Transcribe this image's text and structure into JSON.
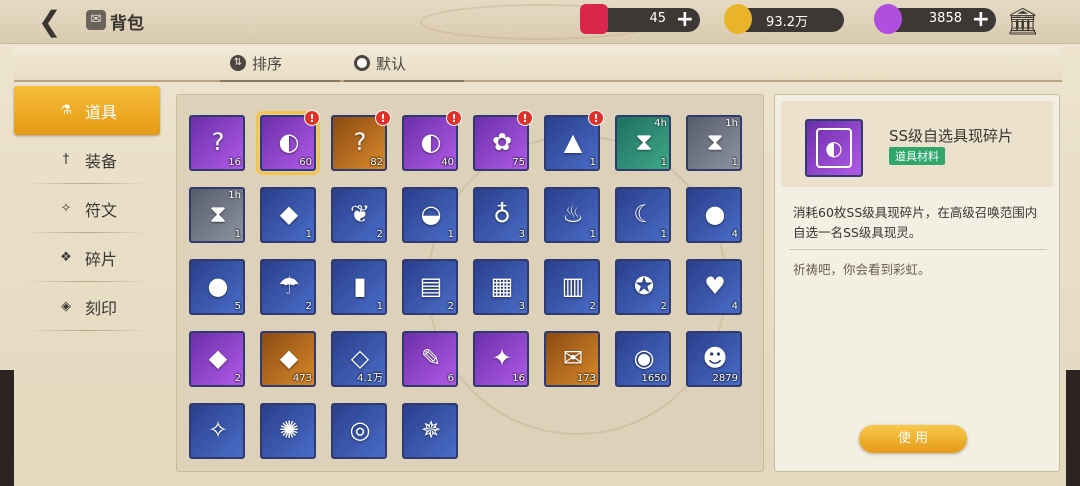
{
  "header": {
    "title": "背包",
    "resources": [
      {
        "name": "ticket",
        "value": "45",
        "color": "#d9264a"
      },
      {
        "name": "gold",
        "value": "93.2万",
        "color": "#e9b42a"
      },
      {
        "name": "gem",
        "value": "3858",
        "color": "#b04ee0"
      }
    ]
  },
  "sortbar": {
    "sort_label": "排序",
    "default_label": "默认"
  },
  "nav": [
    {
      "label": "道具",
      "icon": "flask-icon",
      "active": true
    },
    {
      "label": "装备",
      "icon": "sword-icon",
      "active": false
    },
    {
      "label": "符文",
      "icon": "rune-icon",
      "active": false
    },
    {
      "label": "碎片",
      "icon": "shard-icon",
      "active": false
    },
    {
      "label": "刻印",
      "icon": "seal-icon",
      "active": false
    }
  ],
  "items": [
    {
      "icon": "?",
      "quality": "q-purple",
      "count": "16"
    },
    {
      "icon": "◐",
      "quality": "q-purple",
      "count": "60",
      "badge": "!",
      "selected": true
    },
    {
      "icon": "?",
      "quality": "q-orange",
      "count": "82",
      "badge": "!"
    },
    {
      "icon": "◐",
      "quality": "q-purple",
      "count": "40",
      "badge": "!"
    },
    {
      "icon": "✿",
      "quality": "q-purple",
      "count": "75",
      "badge": "!"
    },
    {
      "icon": "▲",
      "quality": "q-blue",
      "count": "1",
      "badge": "!"
    },
    {
      "icon": "⧗",
      "quality": "q-teal",
      "count": "1",
      "timer": "4h"
    },
    {
      "icon": "⧗",
      "quality": "q-gray",
      "count": "1",
      "timer": "1h"
    },
    {
      "icon": "⧗",
      "quality": "q-gray",
      "count": "1",
      "timer": "1h"
    },
    {
      "icon": "◆",
      "quality": "q-blue",
      "count": "1"
    },
    {
      "icon": "❦",
      "quality": "q-blue",
      "count": "2"
    },
    {
      "icon": "◒",
      "quality": "q-blue",
      "count": "1"
    },
    {
      "icon": "♁",
      "quality": "q-blue",
      "count": "3"
    },
    {
      "icon": "♨",
      "quality": "q-blue",
      "count": "1"
    },
    {
      "icon": "☾",
      "quality": "q-blue",
      "count": "1"
    },
    {
      "icon": "●",
      "quality": "q-blue",
      "count": "4"
    },
    {
      "icon": "●",
      "quality": "q-blue",
      "count": "5"
    },
    {
      "icon": "☂",
      "quality": "q-blue",
      "count": "2"
    },
    {
      "icon": "▮",
      "quality": "q-blue",
      "count": "1"
    },
    {
      "icon": "▤",
      "quality": "q-blue",
      "count": "2"
    },
    {
      "icon": "▦",
      "quality": "q-blue",
      "count": "3"
    },
    {
      "icon": "▥",
      "quality": "q-blue",
      "count": "2"
    },
    {
      "icon": "✪",
      "quality": "q-blue",
      "count": "2"
    },
    {
      "icon": "♥",
      "quality": "q-blue",
      "count": "4"
    },
    {
      "icon": "◆",
      "quality": "q-purple",
      "count": "2"
    },
    {
      "icon": "◆",
      "quality": "q-orange",
      "count": "473"
    },
    {
      "icon": "◇",
      "quality": "q-blue",
      "count": "4.1万"
    },
    {
      "icon": "✎",
      "quality": "q-purple",
      "count": "6"
    },
    {
      "icon": "✦",
      "quality": "q-purple",
      "count": "16"
    },
    {
      "icon": "✉",
      "quality": "q-orange",
      "count": "173"
    },
    {
      "icon": "◉",
      "quality": "q-blue",
      "count": "1650"
    },
    {
      "icon": "☻",
      "quality": "q-blue",
      "count": "2879"
    },
    {
      "icon": "✧",
      "quality": "q-blue",
      "count": ""
    },
    {
      "icon": "✺",
      "quality": "q-blue",
      "count": ""
    },
    {
      "icon": "◎",
      "quality": "q-blue",
      "count": ""
    },
    {
      "icon": "✵",
      "quality": "q-blue",
      "count": ""
    }
  ],
  "detail": {
    "name": "SS级自选具现碎片",
    "tag": "道具材料",
    "description": "消耗60枚SS级具现碎片，在高级召唤范围内自选一名SS级具现灵。",
    "flavor": "祈祷吧，你会看到彩虹。",
    "use_label": "使 用"
  }
}
